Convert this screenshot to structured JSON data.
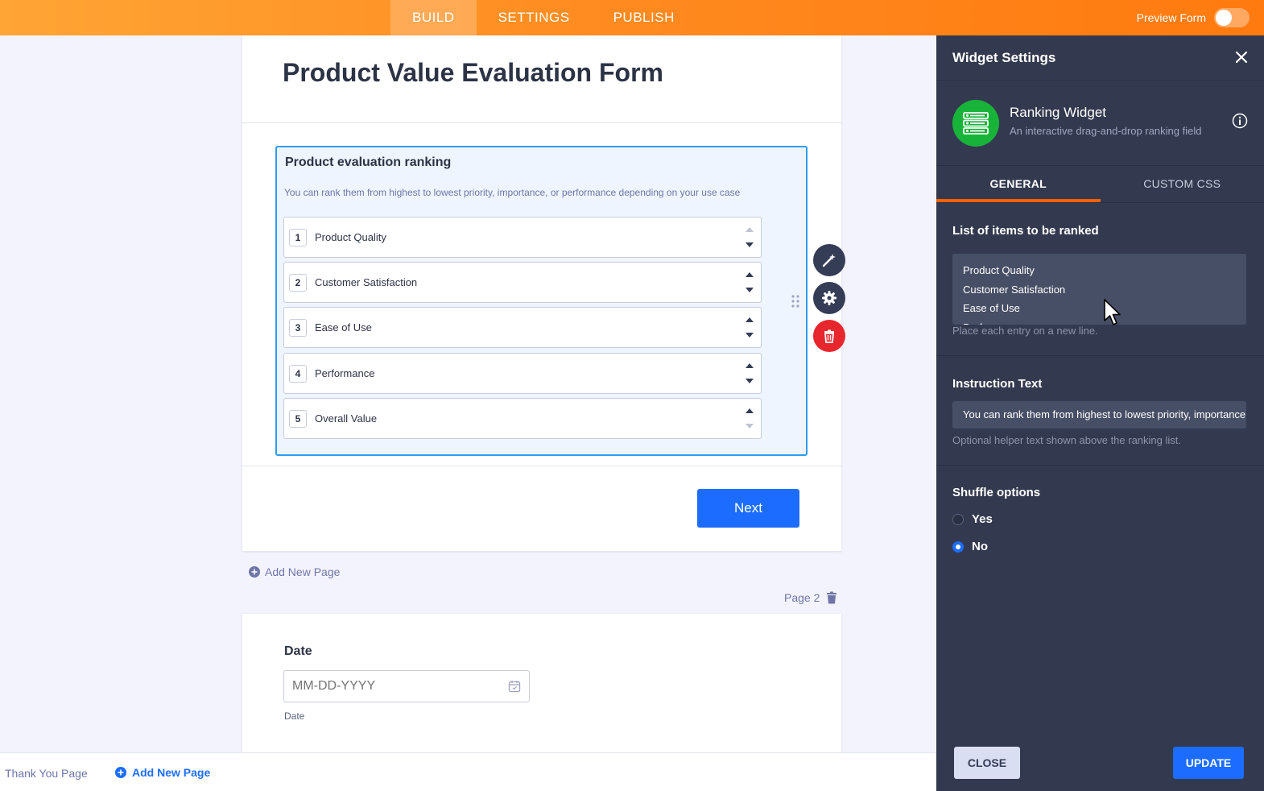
{
  "topbar": {
    "tabs": [
      {
        "label": "BUILD",
        "active": true
      },
      {
        "label": "SETTINGS",
        "active": false
      },
      {
        "label": "PUBLISH",
        "active": false
      }
    ],
    "preview_label": "Preview Form",
    "preview_on": false
  },
  "form": {
    "title": "Product Value Evaluation Form",
    "ranking": {
      "label": "Product evaluation ranking",
      "instruction": "You can rank them from highest to lowest priority, importance, or performance depending on your use case",
      "items": [
        {
          "num": "1",
          "text": "Product Quality"
        },
        {
          "num": "2",
          "text": "Customer Satisfaction"
        },
        {
          "num": "3",
          "text": "Ease of Use"
        },
        {
          "num": "4",
          "text": "Performance"
        },
        {
          "num": "5",
          "text": "Overall Value"
        }
      ]
    },
    "next_label": "Next",
    "add_page_label": "Add New Page",
    "page2_label": "Page 2",
    "date": {
      "label": "Date",
      "placeholder": "MM-DD-YYYY",
      "sublabel": "Date"
    }
  },
  "bottom": {
    "thank_you": "Thank You Page",
    "add_page": "Add New Page"
  },
  "panel": {
    "title": "Widget Settings",
    "widget_name": "Ranking Widget",
    "widget_desc": "An interactive drag-and-drop ranking field",
    "tabs": [
      {
        "label": "GENERAL",
        "active": true
      },
      {
        "label": "CUSTOM CSS",
        "active": false
      }
    ],
    "items_section": {
      "label": "List of items to be ranked",
      "lines": [
        "Product Quality",
        "Customer Satisfaction",
        "Ease of Use",
        "Performance"
      ],
      "hint": "Place each entry on a new line."
    },
    "instruction_section": {
      "label": "Instruction Text",
      "value": "You can rank them from highest to lowest priority, importance, or performance depending on your use case",
      "hint": "Optional helper text shown above the ranking list."
    },
    "shuffle_section": {
      "label": "Shuffle options",
      "options": [
        {
          "label": "Yes",
          "checked": false
        },
        {
          "label": "No",
          "checked": true
        }
      ]
    },
    "close_label": "CLOSE",
    "update_label": "UPDATE"
  },
  "colors": {
    "accent": "#1c6dff",
    "topbar": "#ff8a1f",
    "panel": "#333a4f",
    "selected_border": "#2e9cf0",
    "delete": "#e8262d",
    "widget_icon": "#18b43a"
  },
  "icons": [
    "wand-icon",
    "gear-icon",
    "trash-icon",
    "drag-handle-icon",
    "close-icon",
    "info-icon",
    "calendar-icon",
    "plus-circle-icon",
    "arrow-up-icon",
    "arrow-down-icon",
    "ranking-list-icon"
  ]
}
